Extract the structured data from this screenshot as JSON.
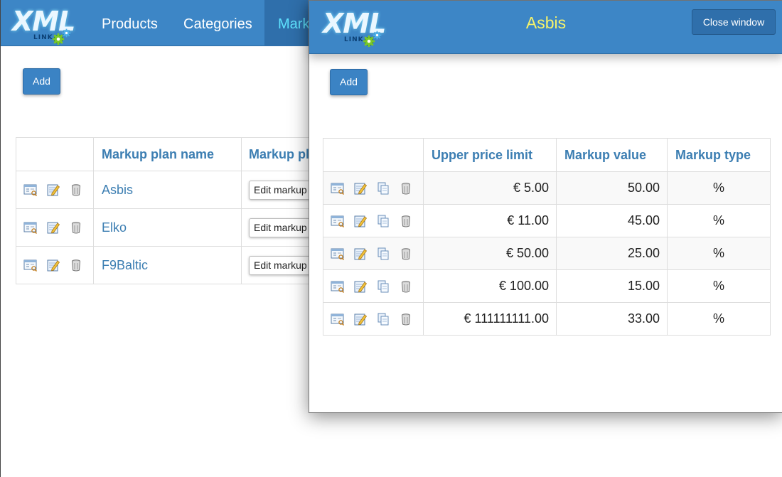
{
  "logo": {
    "main": "XML",
    "sub": "LINK"
  },
  "nav": {
    "items": [
      "Products",
      "Categories"
    ],
    "active": "Markup plans"
  },
  "main": {
    "add_label": "Add",
    "table": {
      "headers": [
        "",
        "Markup plan name",
        "Markup plan"
      ],
      "rows": [
        {
          "name": "Asbis",
          "action": "Edit markup plan"
        },
        {
          "name": "Elko",
          "action": "Edit markup plan"
        },
        {
          "name": "F9Baltic",
          "action": "Edit markup plan"
        }
      ]
    }
  },
  "modal": {
    "title": "Asbis",
    "close_label": "Close window",
    "add_label": "Add",
    "table": {
      "headers": [
        "",
        "Upper price limit",
        "Markup value",
        "Markup type"
      ],
      "rows": [
        {
          "limit": "€ 5.00",
          "value": "50.00",
          "type": "%"
        },
        {
          "limit": "€ 11.00",
          "value": "45.00",
          "type": "%"
        },
        {
          "limit": "€ 50.00",
          "value": "25.00",
          "type": "%"
        },
        {
          "limit": "€ 100.00",
          "value": "15.00",
          "type": "%"
        },
        {
          "limit": "€ 111111111.00",
          "value": "33.00",
          "type": "%"
        }
      ]
    }
  },
  "colors": {
    "navbar": "#3d86c6",
    "link": "#3c7eb2",
    "modal_title": "#f6f36a",
    "active_nav_text": "#5fe3ff"
  },
  "icons": [
    "view-details-icon",
    "edit-icon",
    "copy-icon",
    "delete-icon"
  ]
}
